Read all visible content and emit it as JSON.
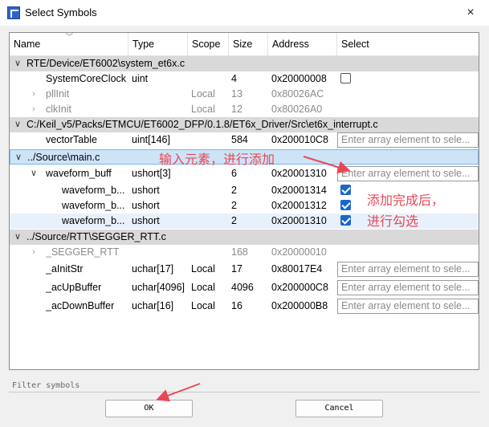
{
  "window": {
    "title": "Select Symbols",
    "close_icon": "×"
  },
  "columns": {
    "name": "Name",
    "type": "Type",
    "scope": "Scope",
    "size": "Size",
    "address": "Address",
    "select": "Select"
  },
  "rows": {
    "r0": {
      "name": "RTE/Device/ET6002\\system_et6x.c"
    },
    "r1": {
      "name": "SystemCoreClock",
      "type": "uint",
      "size": "4",
      "address": "0x20000008"
    },
    "r2": {
      "name": "pllInit",
      "scope": "Local",
      "size": "13",
      "address": "0x80026AC"
    },
    "r3": {
      "name": "clkInit",
      "scope": "Local",
      "size": "12",
      "address": "0x80026A0"
    },
    "r4": {
      "name": "C:/Keil_v5/Packs/ETMCU/ET6002_DFP/0.1.8/ET6x_Driver/Src\\et6x_interrupt.c"
    },
    "r5": {
      "name": "vectorTable",
      "type": "uint[146]",
      "size": "584",
      "address": "0x200010C8",
      "placeholder": "Enter array element to sele..."
    },
    "r6": {
      "name": "../Source\\main.c"
    },
    "r7": {
      "name": "waveform_buff",
      "type": "ushort[3]",
      "size": "6",
      "address": "0x20001310",
      "placeholder": "Enter array element to sele..."
    },
    "r8": {
      "name": "waveform_b...",
      "type": "ushort",
      "size": "2",
      "address": "0x20001314"
    },
    "r9": {
      "name": "waveform_b...",
      "type": "ushort",
      "size": "2",
      "address": "0x20001312"
    },
    "r10": {
      "name": "waveform_b...",
      "type": "ushort",
      "size": "2",
      "address": "0x20001310"
    },
    "r11": {
      "name": "../Source/RTT\\SEGGER_RTT.c"
    },
    "r12": {
      "name": "_SEGGER_RTT",
      "size": "168",
      "address": "0x20000010"
    },
    "r13": {
      "name": "_aInitStr",
      "type": "uchar[17]",
      "scope": "Local",
      "size": "17",
      "address": "0x80017E4",
      "placeholder": "Enter array element to sele..."
    },
    "r14": {
      "name": "_acUpBuffer",
      "type": "uchar[4096]",
      "scope": "Local",
      "size": "4096",
      "address": "0x200000C8",
      "placeholder": "Enter array element to sele..."
    },
    "r15": {
      "name": "_acDownBuffer",
      "type": "uchar[16]",
      "scope": "Local",
      "size": "16",
      "address": "0x200000B8",
      "placeholder": "Enter array element to sele..."
    }
  },
  "checkbox_state": {
    "r1": false,
    "r8": true,
    "r9": true,
    "r10": true
  },
  "filter": {
    "placeholder": "Filter symbols"
  },
  "buttons": {
    "ok": "OK",
    "cancel": "Cancel"
  },
  "annotations": {
    "input_note": "输入元素，进行添加",
    "check_note_line1": "添加完成后，",
    "check_note_line2": "进行勾选",
    "color": "#e84855"
  },
  "icons": {
    "expand": "chevron-down-icon",
    "collapse": "chevron-right-icon",
    "check": "checkmark-icon"
  }
}
